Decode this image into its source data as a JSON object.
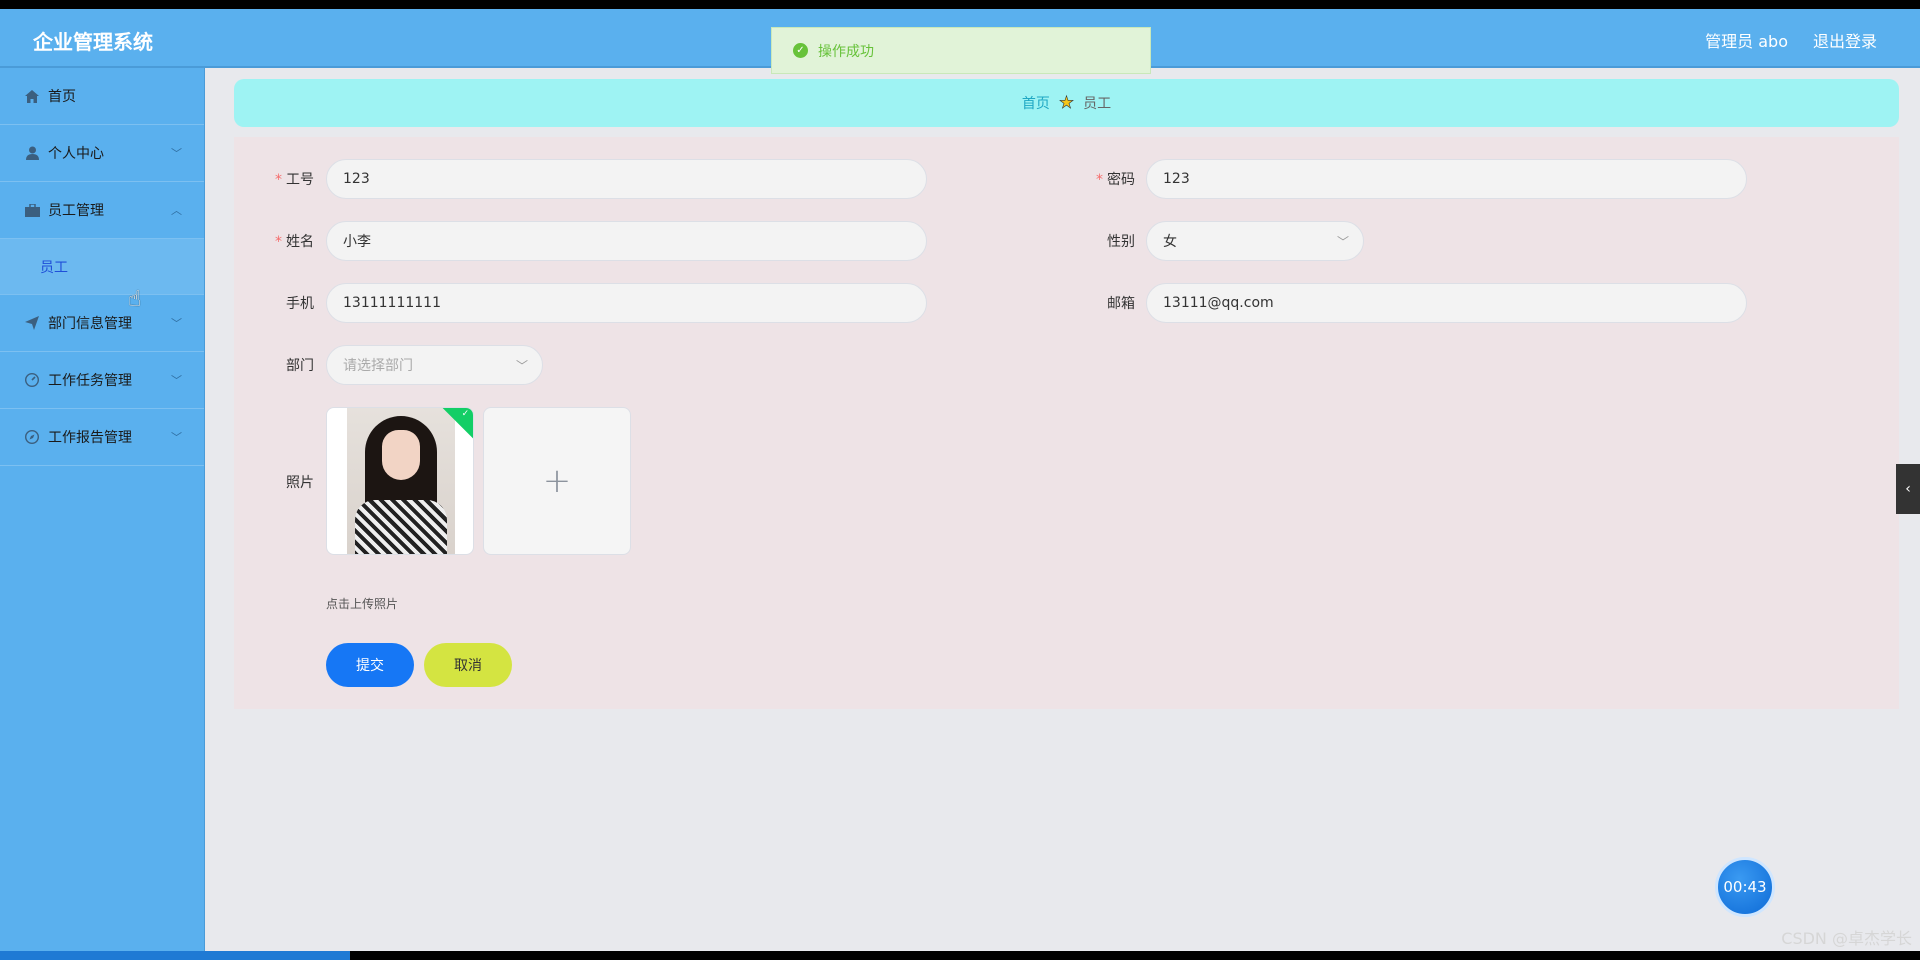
{
  "header": {
    "brand": "企业管理系统",
    "user": "管理员 abo",
    "logout": "退出登录"
  },
  "toast": {
    "message": "操作成功",
    "icon": "check-circle-icon"
  },
  "sidebar": {
    "items": [
      {
        "label": "首页",
        "icon": "home-icon"
      },
      {
        "label": "个人中心",
        "icon": "user-icon"
      },
      {
        "label": "员工管理",
        "icon": "briefcase-icon"
      },
      {
        "label": "部门信息管理",
        "icon": "send-icon"
      },
      {
        "label": "工作任务管理",
        "icon": "dashboard-icon"
      },
      {
        "label": "工作报告管理",
        "icon": "compass-icon"
      }
    ],
    "submenu_active": "员工"
  },
  "breadcrumb": {
    "home": "首页",
    "current": "员工"
  },
  "form": {
    "employee_no": {
      "label": "工号",
      "value": "123"
    },
    "password": {
      "label": "密码",
      "value": "123"
    },
    "name": {
      "label": "姓名",
      "value": "小李"
    },
    "gender": {
      "label": "性别",
      "value": "女"
    },
    "phone": {
      "label": "手机",
      "value": "13111111111"
    },
    "email": {
      "label": "邮箱",
      "value": "13111@qq.com"
    },
    "department": {
      "label": "部门",
      "placeholder": "请选择部门"
    },
    "photo": {
      "label": "照片",
      "hint": "点击上传照片"
    },
    "submit": "提交",
    "cancel": "取消"
  },
  "timer": "00:43",
  "watermark": "CSDN @卓杰学长",
  "colors": {
    "header_bg": "#5ab0ee",
    "breadcrumb_bg": "#9ef3f3",
    "form_bg": "#eee3e6",
    "submit_bg": "#1677f5",
    "cancel_bg": "#d4e441"
  }
}
